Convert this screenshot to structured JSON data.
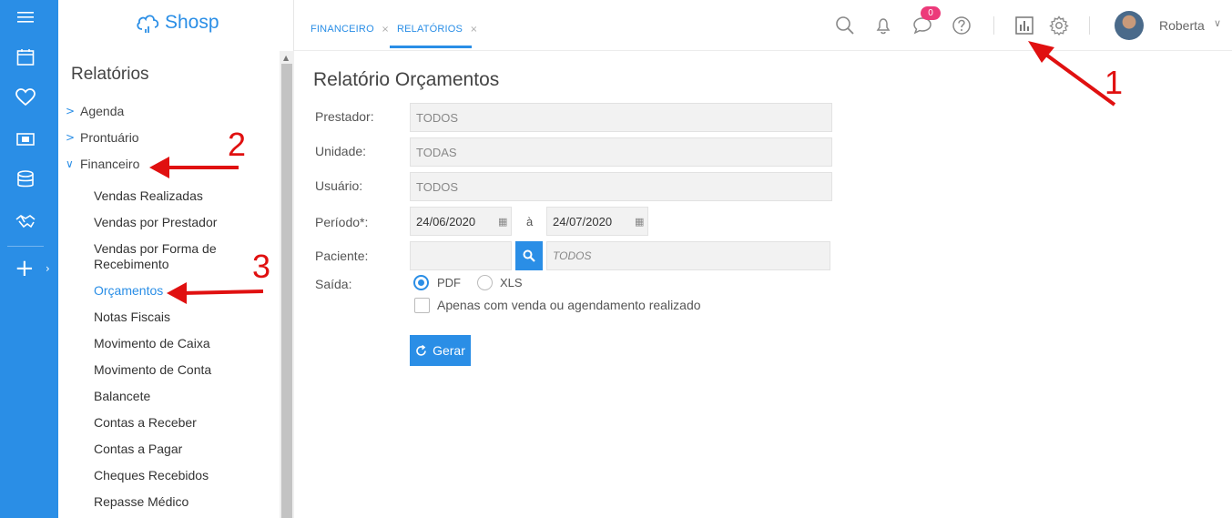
{
  "rail": {
    "icons": [
      "menu-icon",
      "calendar-icon",
      "heart-icon",
      "money-icon",
      "database-icon",
      "handshake-icon",
      "plus-icon",
      "chevron-right-icon"
    ]
  },
  "brand": {
    "name": "Shosp",
    "color": "#2a8ee6"
  },
  "sidebar": {
    "title": "Relatórios",
    "sections": [
      {
        "label": "Agenda",
        "expanded": false
      },
      {
        "label": "Prontuário",
        "expanded": false
      },
      {
        "label": "Financeiro",
        "expanded": true
      }
    ],
    "financeiro_items": [
      {
        "label": "Vendas Realizadas"
      },
      {
        "label": "Vendas por Prestador"
      },
      {
        "label": "Vendas por Forma de Recebimento"
      },
      {
        "label": "Orçamentos",
        "active": true
      },
      {
        "label": "Notas Fiscais"
      },
      {
        "label": "Movimento de Caixa"
      },
      {
        "label": "Movimento de Conta"
      },
      {
        "label": "Balancete"
      },
      {
        "label": "Contas a Receber"
      },
      {
        "label": "Contas a Pagar"
      },
      {
        "label": "Cheques Recebidos"
      },
      {
        "label": "Repasse Médico"
      }
    ]
  },
  "topbar": {
    "tabs": [
      {
        "label": "FINANCEIRO",
        "active": false
      },
      {
        "label": "RELATÓRIOS",
        "active": true
      }
    ],
    "tab_close": "×",
    "messages_badge": "0",
    "user_name": "Roberta",
    "icons": [
      "search-icon",
      "bell-icon",
      "chat-icon",
      "help-icon",
      "reports-icon",
      "gear-icon",
      "chevron-down-icon"
    ]
  },
  "form": {
    "title": "Relatório Orçamentos",
    "labels": {
      "prestador": "Prestador:",
      "unidade": "Unidade:",
      "usuario": "Usuário:",
      "periodo": "Período*:",
      "paciente": "Paciente:",
      "saida": "Saída:"
    },
    "values": {
      "prestador": "TODOS",
      "unidade": "TODAS",
      "usuario": "TODOS",
      "periodo_inicio": "24/06/2020",
      "periodo_fim": "24/07/2020",
      "paciente_id": "",
      "paciente_nome": "TODOS"
    },
    "periodo_sep": "à",
    "saida_options": [
      {
        "label": "PDF",
        "selected": true
      },
      {
        "label": "XLS",
        "selected": false
      }
    ],
    "checkbox_label": "Apenas com venda ou agendamento realizado",
    "checkbox_checked": false,
    "submit_label": "Gerar"
  },
  "annotations": {
    "numbers": [
      "1",
      "2",
      "3"
    ],
    "color": "#e01010"
  }
}
